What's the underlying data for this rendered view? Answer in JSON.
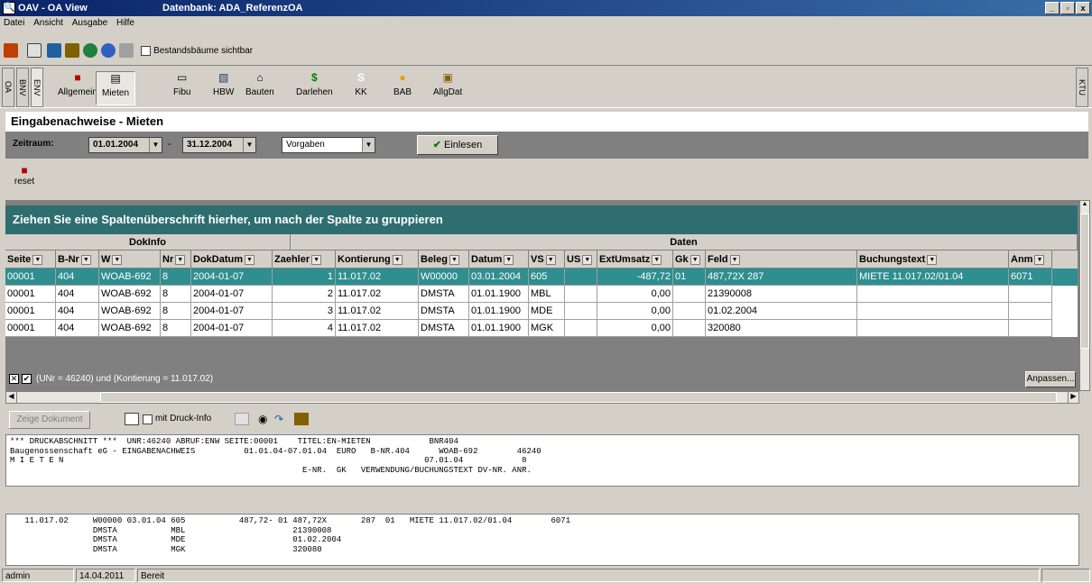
{
  "window": {
    "title": "OAV - OA View",
    "database": "Datenbank: ADA_ReferenzOA",
    "icon": "magnifier-icon",
    "controls": [
      "_",
      "▫",
      "x"
    ]
  },
  "menu": [
    "Datei",
    "Ansicht",
    "Ausgabe",
    "Hilfe"
  ],
  "toolbar": {
    "checkbox_label": "Bestandsbäume sichtbar",
    "icons": [
      "tree-icon",
      "print-icon",
      "mail-icon",
      "edit-icon",
      "globe-icon",
      "help-icon",
      "binoculars-icon"
    ]
  },
  "nav": {
    "left_tabs": [
      "OA",
      "BNV",
      "ENV"
    ],
    "right_tab": "KTU",
    "buttons": [
      {
        "label": "Allgemein",
        "icon": "folder-red-icon"
      },
      {
        "label": "Mieten",
        "icon": "document-icon"
      },
      {
        "label": "Fibu",
        "icon": "card-icon"
      },
      {
        "label": "HBW",
        "icon": "calculator-icon"
      },
      {
        "label": "Bauten",
        "icon": "house-icon"
      },
      {
        "label": "Darlehen",
        "icon": "dollar-icon"
      },
      {
        "label": "KK",
        "icon": "s-icon"
      },
      {
        "label": "BAB",
        "icon": "pin-icon"
      },
      {
        "label": "AllgDat",
        "icon": "briefcase-icon"
      }
    ],
    "active": "Mieten"
  },
  "page": {
    "title": "Eingabenachweise - Mieten"
  },
  "filter": {
    "label": "Zeitraum:",
    "from": "01.01.2004",
    "sep": "-",
    "to": "31.12.2004",
    "mode": "Vorgaben",
    "button": "Einlesen"
  },
  "reset": {
    "label": "reset"
  },
  "grid": {
    "group_hint": "Ziehen Sie eine Spaltenüberschrift hierher, um nach der Spalte zu gruppieren",
    "band1": "DokInfo",
    "band2": "Daten",
    "columns": [
      "Seite",
      "B-Nr",
      "W",
      "Nr",
      "DokDatum",
      "Zaehler",
      "Kontierung",
      "Beleg",
      "Datum",
      "VS",
      "US",
      "ExtUmsatz",
      "Gk",
      "Feld",
      "Buchungstext",
      "Anm"
    ],
    "rows": [
      [
        "00001",
        "404",
        "WOAB-692",
        "8",
        "2004-01-07",
        "1",
        "11.017.02",
        "W00000",
        "03.01.2004",
        "605",
        "",
        "-487,72",
        "01",
        "487,72X        287",
        "MIETE 11.017.02/01.04",
        "6071"
      ],
      [
        "00001",
        "404",
        "WOAB-692",
        "8",
        "2004-01-07",
        "2",
        "11.017.02",
        "DMSTA",
        "01.01.1900",
        "MBL",
        "",
        "0,00",
        "",
        "21390008",
        "",
        ""
      ],
      [
        "00001",
        "404",
        "WOAB-692",
        "8",
        "2004-01-07",
        "3",
        "11.017.02",
        "DMSTA",
        "01.01.1900",
        "MDE",
        "",
        "0,00",
        "",
        "01.02.2004",
        "",
        ""
      ],
      [
        "00001",
        "404",
        "WOAB-692",
        "8",
        "2004-01-07",
        "4",
        "11.017.02",
        "DMSTA",
        "01.01.1900",
        "MGK",
        "",
        "0,00",
        "",
        "320080",
        "",
        ""
      ]
    ],
    "filter_text": "(UNr = 46240) und (Kontierung = 11.017.02)",
    "customize": "Anpassen..."
  },
  "doc": {
    "show_button": "Zeige Dokument",
    "print_info": "mit Druck-Info"
  },
  "print1": "*** DRUCKABSCHNITT ***  UNR:46240 ABRUF:ENW SEITE:00001    TITEL:EN-MIETEN            BNR404\nBaugenossenschaft eG - EINGABENACHWEIS          01.01.04-07.01.04  EURO   B-NR.404      WOAB-692        46240\nM I E T E N                                                                          07.01.04            8\n                                                            E-NR.  GK   VERWENDUNG/BUCHUNGSTEXT DV-NR. ANR.",
  "print2": "   11.017.02     W00000 03.01.04 605           487,72- 01 487,72X       287  01   MIETE 11.017.02/01.04        6071\n                 DMSTA           MBL                      21390008\n                 DMSTA           MDE                      01.02.2004\n                 DMSTA           MGK                      320080",
  "status": {
    "user": "admin",
    "date": "14.04.2011",
    "state": "Bereit"
  }
}
